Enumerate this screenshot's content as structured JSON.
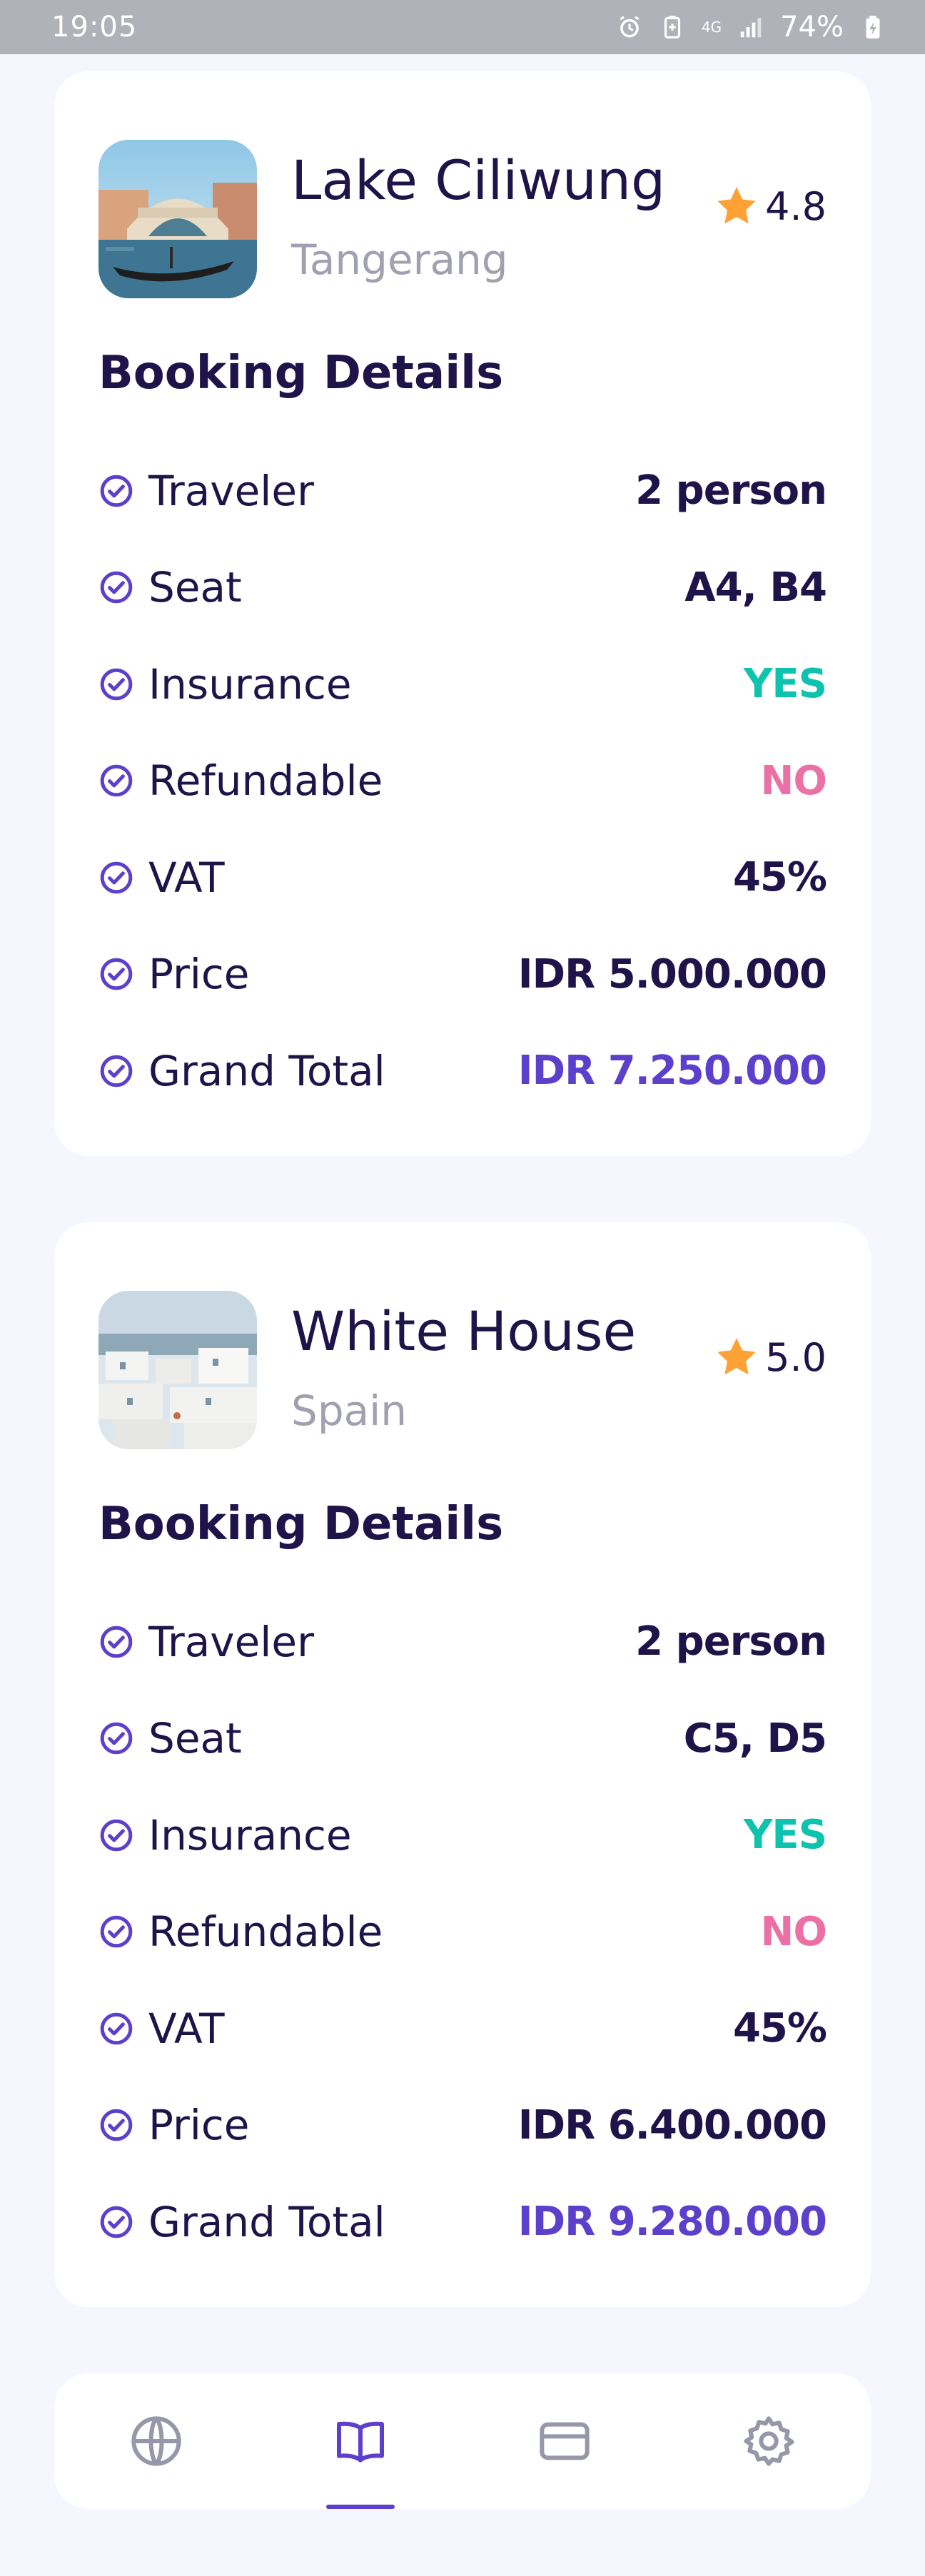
{
  "status_bar": {
    "time": "19:05",
    "battery": "74%",
    "network": "4G"
  },
  "bookings": [
    {
      "destination": "Lake Ciliwung",
      "city": "Tangerang",
      "rating": "4.8",
      "section_title": "Booking Details",
      "details": [
        {
          "label": "Traveler",
          "value": "2 person",
          "color": "#1F1449"
        },
        {
          "label": "Seat",
          "value": "A4, B4",
          "color": "#1F1449"
        },
        {
          "label": "Insurance",
          "value": "YES",
          "color": "#0EC3AE"
        },
        {
          "label": "Refundable",
          "value": "NO",
          "color": "#EB70A5"
        },
        {
          "label": "VAT",
          "value": "45%",
          "color": "#1F1449"
        },
        {
          "label": "Price",
          "value": "IDR 5.000.000",
          "color": "#1F1449"
        },
        {
          "label": "Grand Total",
          "value": "IDR 7.250.000",
          "color": "#5C40CC"
        }
      ]
    },
    {
      "destination": "White House",
      "city": "Spain",
      "rating": "5.0",
      "section_title": "Booking Details",
      "details": [
        {
          "label": "Traveler",
          "value": "2 person",
          "color": "#1F1449"
        },
        {
          "label": "Seat",
          "value": "C5, D5",
          "color": "#1F1449"
        },
        {
          "label": "Insurance",
          "value": "YES",
          "color": "#0EC3AE"
        },
        {
          "label": "Refundable",
          "value": "NO",
          "color": "#EB70A5"
        },
        {
          "label": "VAT",
          "value": "45%",
          "color": "#1F1449"
        },
        {
          "label": "Price",
          "value": "IDR 6.400.000",
          "color": "#1F1449"
        },
        {
          "label": "Grand Total",
          "value": "IDR 9.280.000",
          "color": "#5C40CC"
        }
      ]
    }
  ],
  "bottom_nav": {
    "items": [
      {
        "icon": "globe-icon",
        "active": false
      },
      {
        "icon": "book-icon",
        "active": true
      },
      {
        "icon": "credit-card-icon",
        "active": false
      },
      {
        "icon": "gear-icon",
        "active": false
      }
    ],
    "active_color": "#5C40CC",
    "inactive_color": "#9698A9"
  },
  "colors": {
    "accent": "#5C40CC",
    "yes": "#0EC3AE",
    "no": "#EB70A5",
    "star": "#FFA235",
    "text_primary": "#1F1449",
    "text_secondary": "#A0A0B0"
  }
}
